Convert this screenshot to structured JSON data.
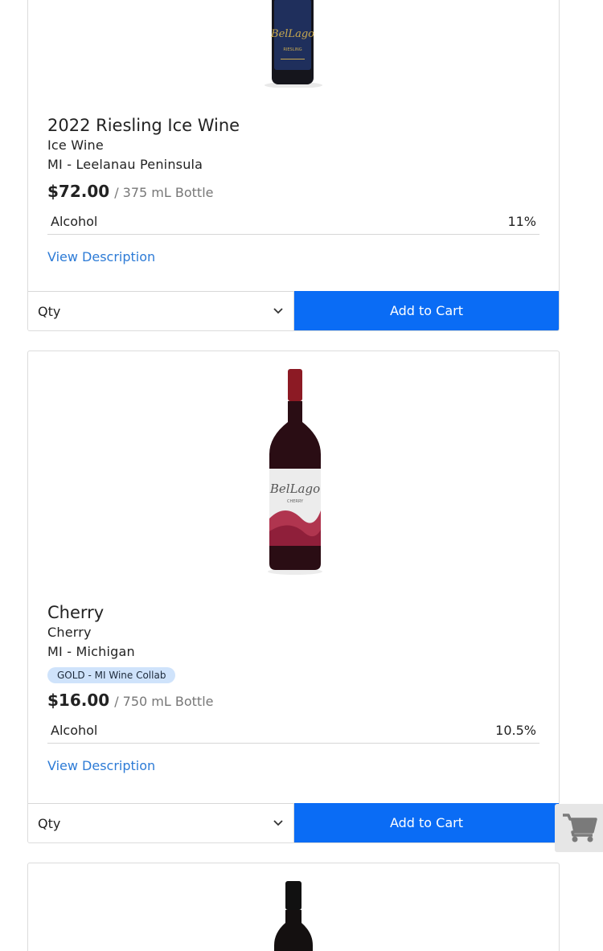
{
  "products": [
    {
      "name": "2022 Riesling Ice Wine",
      "type": "Ice Wine",
      "region": "MI - Leelanau Peninsula",
      "price": "$72.00",
      "unit": "/ 375 mL Bottle",
      "attr_label": "Alcohol",
      "attr_value": "11%",
      "desc_link": "View Description",
      "qty_placeholder": "Qty",
      "add_label": "Add to Cart",
      "label_text": "BelLago",
      "label_sub": "RIESLING"
    },
    {
      "name": "Cherry",
      "type": "Cherry",
      "region": "MI - Michigan",
      "badge": "GOLD - MI Wine Collab",
      "price": "$16.00",
      "unit": "/ 750 mL Bottle",
      "attr_label": "Alcohol",
      "attr_value": "10.5%",
      "desc_link": "View Description",
      "qty_placeholder": "Qty",
      "add_label": "Add to Cart",
      "label_text": "BelLago",
      "label_sub": "CHERRY"
    }
  ],
  "colors": {
    "accent": "#0a6cf5",
    "link": "#2d7bd6",
    "badge_bg": "#cfe3fb"
  },
  "icons": {
    "cart": "shopping-cart-icon",
    "chevron": "chevron-down-icon"
  }
}
